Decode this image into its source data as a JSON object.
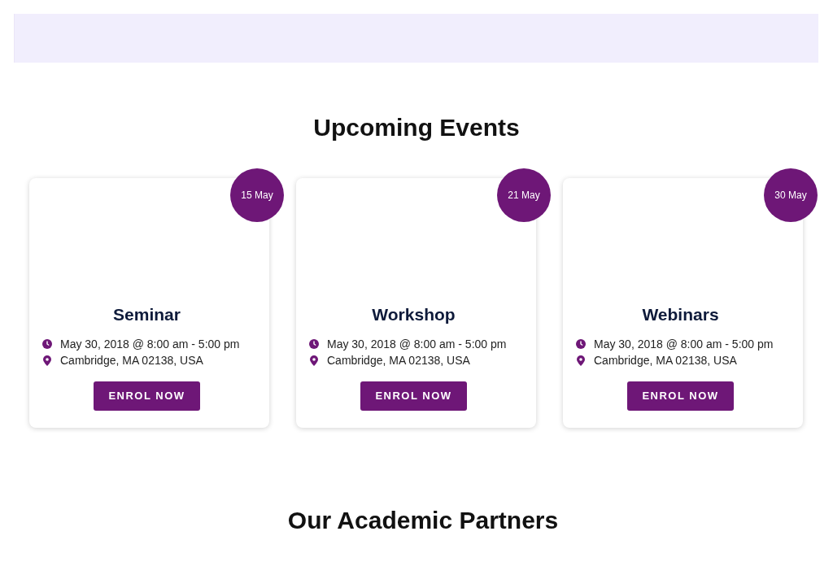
{
  "events_section": {
    "title": "Upcoming Events",
    "events": [
      {
        "date": "15 May",
        "title": "Seminar",
        "time": "May 30, 2018 @ 8:00 am - 5:00 pm",
        "location": "Cambridge, MA 02138, USA",
        "button": "ENROL NOW"
      },
      {
        "date": "21 May",
        "title": "Workshop",
        "time": "May 30, 2018 @ 8:00 am - 5:00 pm",
        "location": "Cambridge, MA 02138, USA",
        "button": "ENROL NOW"
      },
      {
        "date": "30 May",
        "title": "Webinars",
        "time": "May 30, 2018 @ 8:00 am - 5:00 pm",
        "location": "Cambridge, MA 02138, USA",
        "button": "ENROL NOW"
      }
    ]
  },
  "partners_section": {
    "title": "Our Academic Partners"
  }
}
